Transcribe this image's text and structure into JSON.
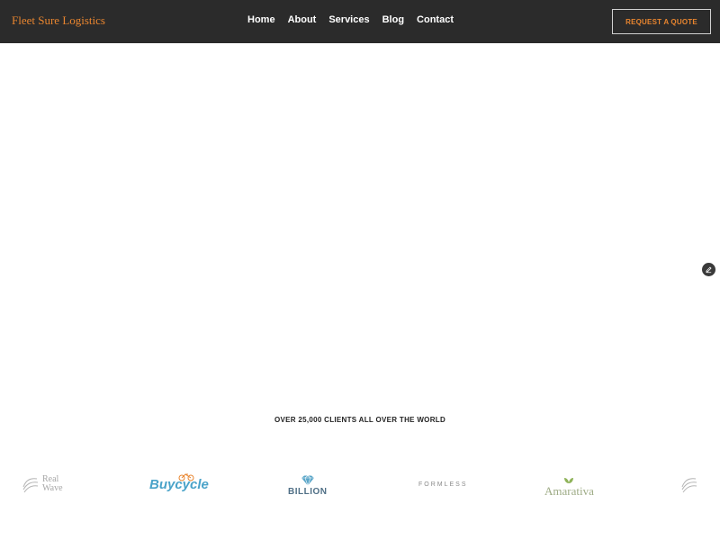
{
  "header": {
    "brand": "Fleet Sure Logistics",
    "nav": [
      {
        "label": "Home"
      },
      {
        "label": "About"
      },
      {
        "label": "Services"
      },
      {
        "label": "Blog"
      },
      {
        "label": "Contact"
      }
    ],
    "cta_label": "REQUEST A QUOTE"
  },
  "edit_button": {
    "icon": "pencil-icon"
  },
  "clients": {
    "caption": "OVER 25,000 CLIENTS ALL OVER THE WORLD",
    "logos": [
      {
        "name": "Real Wave"
      },
      {
        "name": "Buycycle"
      },
      {
        "name": "BILLION"
      },
      {
        "name": "FORMLESS"
      },
      {
        "name": "Amarativa"
      }
    ]
  },
  "colors": {
    "header_bg": "#2b2b2b",
    "accent": "#e8852f",
    "nav_text": "#ffffff"
  }
}
